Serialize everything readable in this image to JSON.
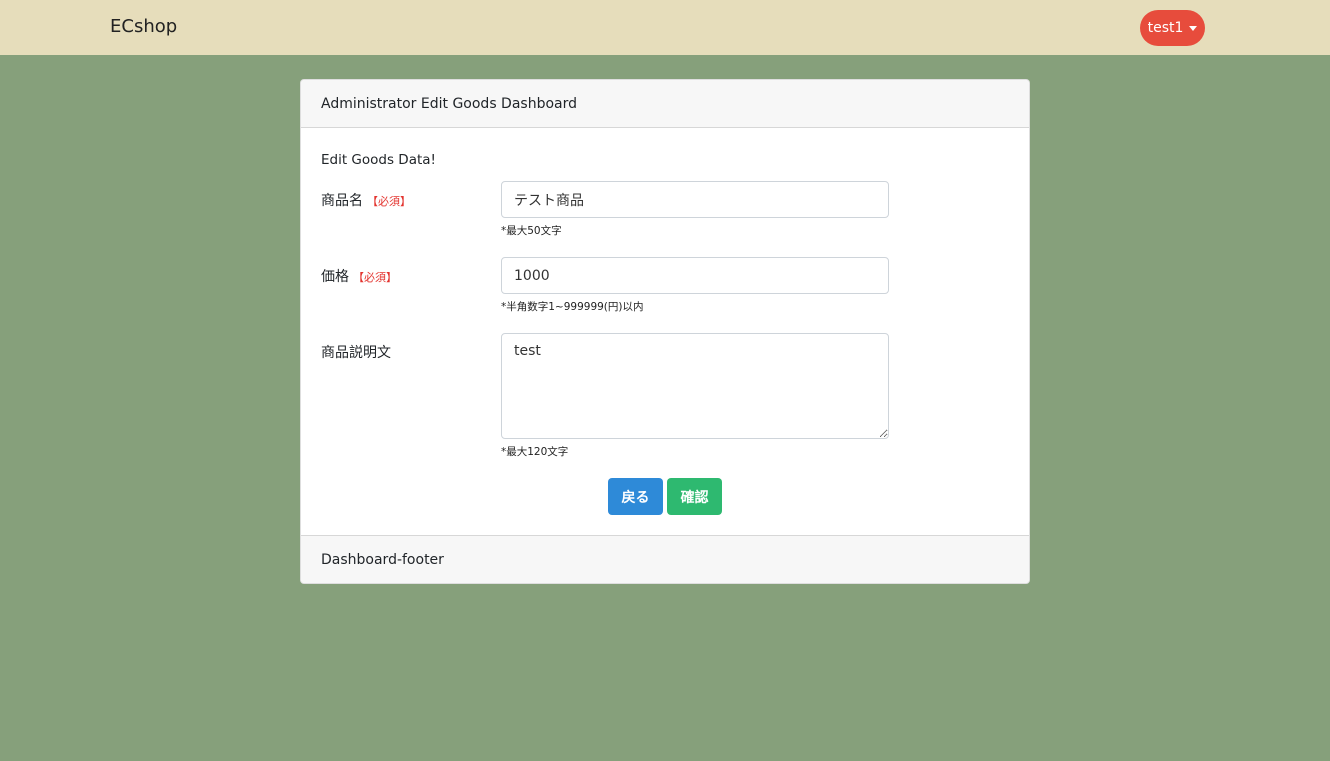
{
  "navbar": {
    "brand": "ECshop",
    "user_menu": "test1"
  },
  "card": {
    "header": "Administrator Edit Goods Dashboard",
    "intro": "Edit Goods Data!",
    "footer": "Dashboard-footer"
  },
  "form": {
    "required_badge": "【必須】",
    "name": {
      "label": "商品名",
      "value": "テスト商品",
      "help": "*最大50文字"
    },
    "price": {
      "label": "価格",
      "value": "1000",
      "help": "*半角数字1~999999(円)以内"
    },
    "description": {
      "label": "商品説明文",
      "value": "test",
      "help": "*最大120文字"
    },
    "back_button": "戻る",
    "confirm_button": "確認"
  },
  "colors": {
    "page_background": "#86a07b",
    "navbar_background": "#e6ddbb",
    "user_menu": "#e74c3c",
    "back_button": "#2e8ad8",
    "confirm_button": "#2eb970",
    "required": "#e3342f"
  },
  "icons": {
    "user_menu": "caret-down-icon"
  }
}
